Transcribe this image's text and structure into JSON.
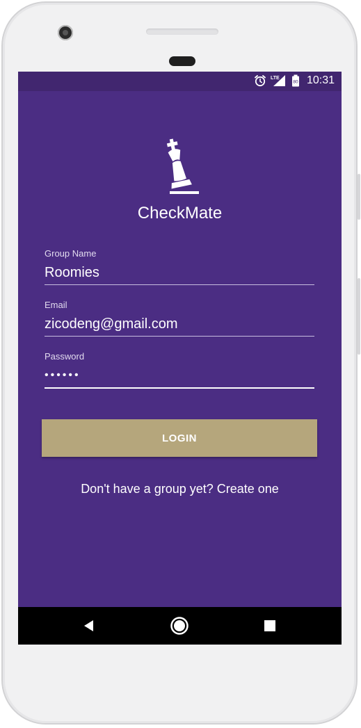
{
  "status_bar": {
    "time": "10:31",
    "network_label": "LTE",
    "battery_level": "80",
    "icons": [
      "alarm-icon",
      "signal-icon",
      "battery-icon"
    ]
  },
  "app": {
    "name": "CheckMate",
    "logo_icon": "chess-king-icon"
  },
  "form": {
    "group_name": {
      "label": "Group Name",
      "value": "Roomies"
    },
    "email": {
      "label": "Email",
      "value": "zicodeng@gmail.com"
    },
    "password": {
      "label": "Password",
      "value": "••••••"
    },
    "login_label": "LOGIN",
    "signup_link": "Don't have a group yet? Create one"
  },
  "nav_bar": {
    "icons": [
      "back-icon",
      "home-icon",
      "recents-icon"
    ]
  },
  "colors": {
    "background": "#4b2d83",
    "status_bar": "#41266f",
    "button": "#b5a67c",
    "text": "#ffffff"
  }
}
